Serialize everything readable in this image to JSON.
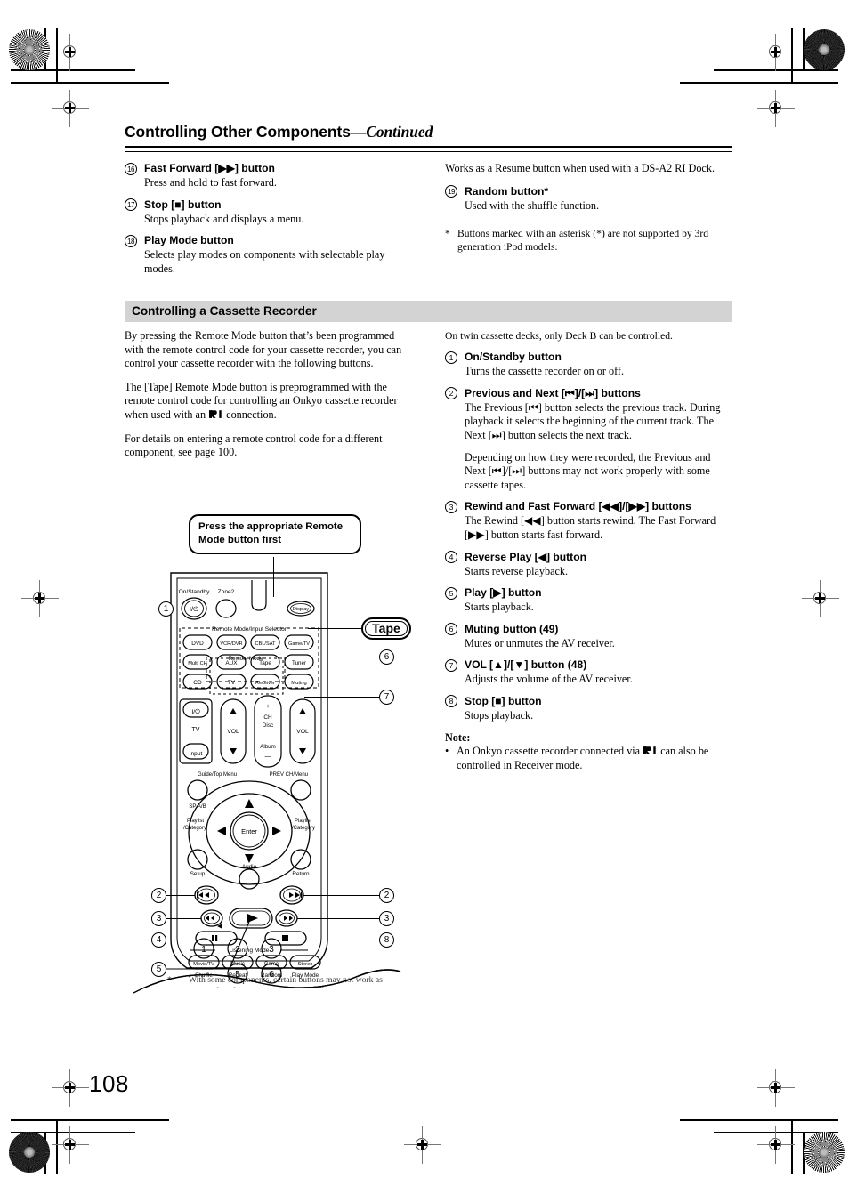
{
  "document": {
    "page_number": "108",
    "header_title": "Controlling Other Components",
    "header_continued": "—Continued"
  },
  "left_column": {
    "items": [
      {
        "num": "16",
        "heading": "Fast Forward [▶▶] button",
        "body": "Press and hold to fast forward."
      },
      {
        "num": "17",
        "heading": "Stop [■] button",
        "body": "Stops playback and displays a menu."
      },
      {
        "num": "18",
        "heading": "Play Mode button",
        "body": "Selects play modes on components with selectable play modes."
      }
    ]
  },
  "right_column_top": {
    "resume_text": "Works as a Resume button when used with a DS-A2 RI Dock.",
    "items": [
      {
        "num": "19",
        "heading": "Random button*",
        "body": "Used with the shuffle function."
      }
    ],
    "footnote": {
      "marker": "*",
      "text": "Buttons marked with an asterisk (*) are not supported by 3rd generation iPod models."
    }
  },
  "section": {
    "band_title": "Controlling a Cassette Recorder"
  },
  "intro_left": {
    "paragraph_1": "By pressing the Remote Mode button that’s been programmed with the remote control code for your cassette recorder, you can control your cassette recorder with the following buttons.",
    "paragraph_2_a": "The [Tape] Remote Mode button is preprogrammed with the remote control code for controlling an Onkyo cassette recorder when used with an ",
    "paragraph_2_b": " connection.",
    "paragraph_3": "For details on entering a remote control code for a different component, see page 100."
  },
  "right_column_main": {
    "lead_text": "On twin cassette decks, only Deck B can be controlled.",
    "items": [
      {
        "num": "1",
        "heading": "On/Standby button",
        "body": "Turns the cassette recorder on or off."
      },
      {
        "num": "2",
        "heading": "Previous and Next [⏮]/[⏭] buttons",
        "body": "The Previous [⏮] button selects the previous track. During playback it selects the beginning of the current track. The Next [⏭] button selects the next track.",
        "body2": "Depending on how they were recorded, the Previous and Next [⏮]/[⏭] buttons may not work properly with some cassette tapes."
      },
      {
        "num": "3",
        "heading": "Rewind and Fast Forward [◀◀]/[▶▶] buttons",
        "body": "The Rewind [◀◀] button starts rewind. The Fast Forward [▶▶] button starts fast forward."
      },
      {
        "num": "4",
        "heading": "Reverse Play [◀] button",
        "body": "Starts reverse playback."
      },
      {
        "num": "5",
        "heading": "Play [▶] button",
        "body": "Starts playback."
      },
      {
        "num": "6",
        "heading": "Muting button (49)",
        "body": "Mutes or unmutes the AV receiver."
      },
      {
        "num": "7",
        "heading": "VOL [▲]/[▼] button (48)",
        "body": "Adjusts the volume of the AV receiver."
      },
      {
        "num": "8",
        "heading": "Stop [■] button",
        "body": "Stops playback."
      }
    ],
    "note_label": "Note:",
    "note_bullet": "•",
    "note_text_a": "An Onkyo cassette recorder connected via ",
    "note_text_b": " can also be controlled in Receiver mode."
  },
  "diagram": {
    "callout_line1": "Press the appropriate Remote",
    "callout_line2": "Mode button first",
    "tape_callout": "Tape",
    "bubbles": [
      "1",
      "2",
      "2",
      "3",
      "3",
      "4",
      "5",
      "6",
      "7",
      "8"
    ],
    "remote_labels": {
      "on_standby": "On/Standby",
      "zone2": "Zone2",
      "display": "Display",
      "power_glyph": "I/⏻",
      "group_remote_mode_input": "Remote Mode/Input Selector",
      "group_remote_mode": "Remote Mode",
      "selector_buttons": [
        "DVD",
        "VCR/DVR",
        "CBL/SAT",
        "Game/TV",
        "Multi CH",
        "AUX",
        "Tape",
        "Tuner",
        "CD"
      ],
      "remote_mode_buttons": [
        "TV",
        "Receiver"
      ],
      "muting": "Muting",
      "tv": "TV",
      "input": "Input",
      "vol_left": "VOL",
      "vol_right": "VOL",
      "ch": "CH",
      "disc": "Disc",
      "album": "Album",
      "plus": "+",
      "minus": "−",
      "guide_top_menu": "Guide/Top Menu",
      "prev_ch_menu": "PREV CH/Menu",
      "sp_ab": "SP A/B",
      "playlist_category_left": "Playlist\n/Category",
      "playlist_category_right": "Playlist\n/Category",
      "enter": "Enter",
      "setup": "Setup",
      "return": "Return",
      "audio": "Audio",
      "listening_mode": "Listening Mode",
      "listening_buttons": [
        "Movie/TV",
        "Music",
        "Game",
        "Stereo"
      ],
      "listening_sub_labels": [
        "Shuffle",
        "Repeat",
        "Random",
        "Play Mode"
      ],
      "numeric_row1": [
        "1",
        "2",
        "3"
      ],
      "numeric_row2": [
        "5",
        "6"
      ]
    },
    "note": {
      "marker": "*",
      "text": "With some components, certain buttons may not work as expected, and some may not work at all."
    }
  }
}
